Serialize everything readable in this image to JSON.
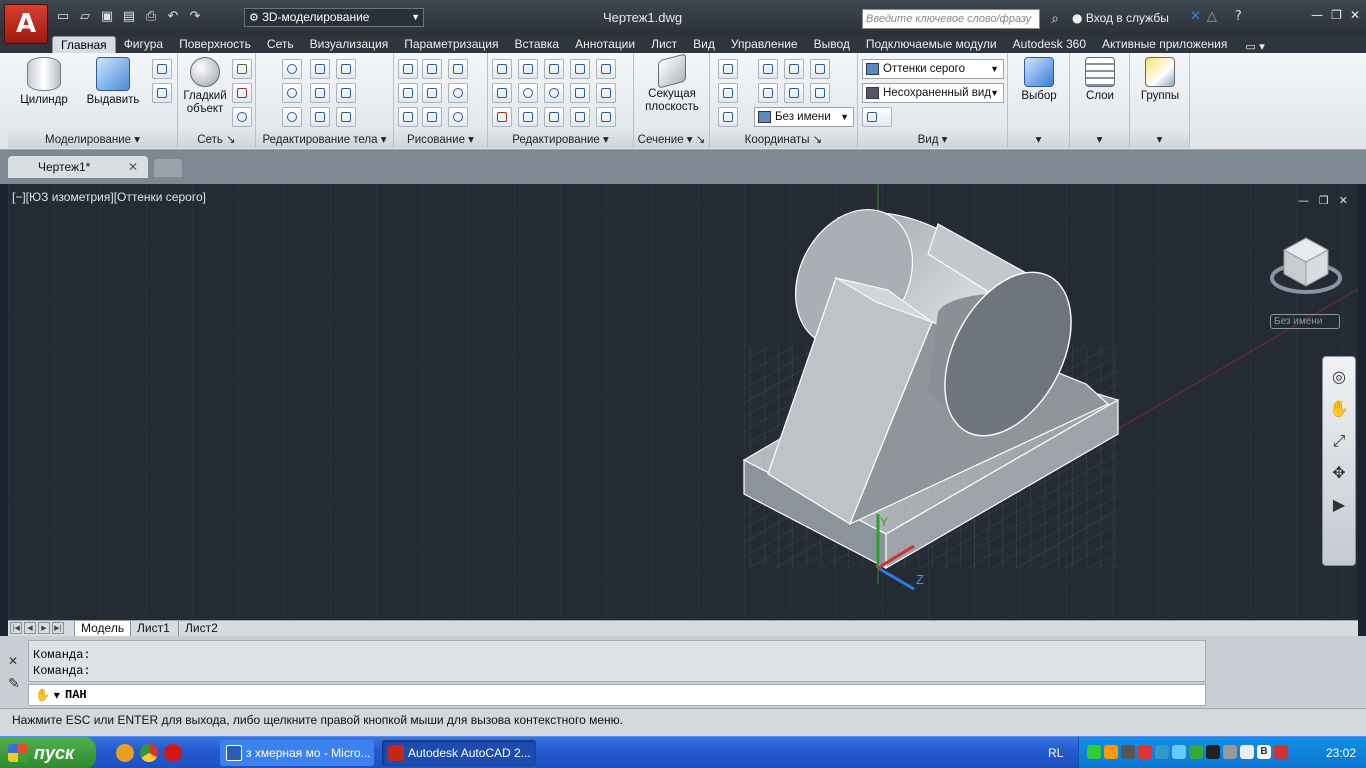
{
  "app": {
    "logo": "A",
    "workspace": "3D-моделирование",
    "title": "Чертеж1.dwg",
    "search_placeholder": "Введите ключевое слово/фразу",
    "signin": "Вход в службы"
  },
  "tabs": [
    "Главная",
    "Фигура",
    "Поверхность",
    "Сеть",
    "Визуализация",
    "Параметризация",
    "Вставка",
    "Аннотации",
    "Лист",
    "Вид",
    "Управление",
    "Вывод",
    "Подключаемые модули",
    "Autodesk 360",
    "Активные приложения"
  ],
  "ribbon": {
    "panels": {
      "modeling": "Моделирование",
      "mesh": "Сеть",
      "solid_edit": "Редактирование тела",
      "draw": "Рисование",
      "modify": "Редактирование",
      "section": "Сечение",
      "coordinates": "Координаты",
      "view": "Вид"
    },
    "buttons": {
      "cylinder": "Цилиндр",
      "extrude": "Выдавить",
      "smooth_object_1": "Гладкий",
      "smooth_object_2": "объект",
      "section_plane_1": "Секущая",
      "section_plane_2": "плоскость",
      "select": "Выбор",
      "layers": "Слои",
      "groups": "Группы"
    },
    "combos": {
      "visual_style": "Оттенки серого",
      "named_view": "Несохраненный вид",
      "ucs": "Без имени"
    }
  },
  "document": {
    "tab": "Чертеж1*"
  },
  "viewport": {
    "label": "[−][ЮЗ изометрия][Оттенки серого]",
    "ucs_name": "Без имени",
    "axis_z": "Z",
    "axis_y": "Y"
  },
  "layout_tabs": [
    "Модель",
    "Лист1",
    "Лист2"
  ],
  "command": {
    "history": [
      "Команда:",
      "Команда:"
    ],
    "input": "ПАН"
  },
  "status": "Нажмите ESC или ENTER для выхода, либо щелкните правой кнопкой мыши для вызова контекстного меню.",
  "taskbar": {
    "start": "пуск",
    "tasks": [
      "з хмерная мо - Micro...",
      "Autodesk AutoCAD 2..."
    ],
    "lang": "RL",
    "clock": "23:02"
  },
  "colors": {
    "viewport_bg": "#242b35",
    "taskbar": "#245bd0",
    "accent": "#c0281a"
  }
}
